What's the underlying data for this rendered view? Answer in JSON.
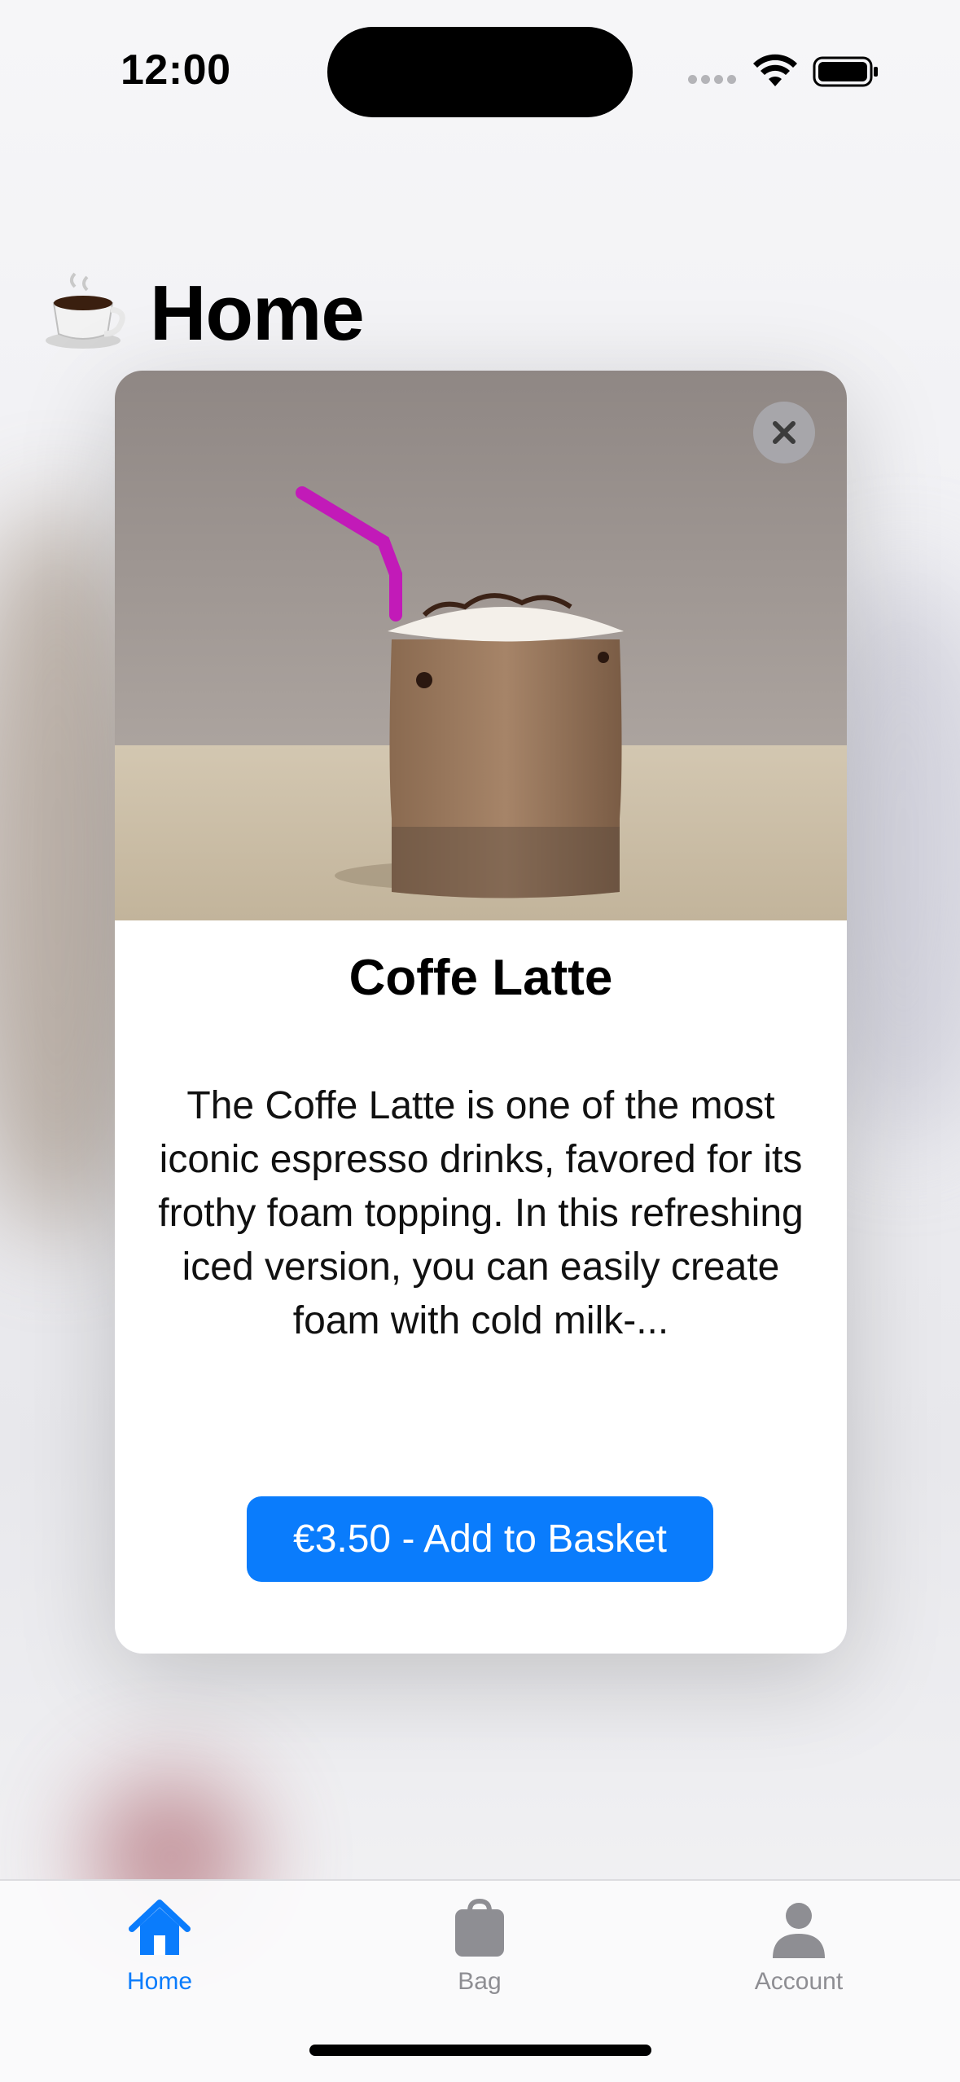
{
  "status_bar": {
    "time": "12:00"
  },
  "header": {
    "icon": "coffee-cup-icon",
    "title": "Home"
  },
  "modal": {
    "image": "iced-latte-photo",
    "close_icon": "close-icon",
    "product_name": "Coffe Latte",
    "description": "The Coffe Latte is one of the most iconic espresso drinks, favored for its frothy foam topping. In this refreshing iced version, you can easily create foam with cold milk-...",
    "add_button_label": "€3.50 - Add to Basket"
  },
  "tab_bar": {
    "active_color": "#0a7cfc",
    "inactive_color": "#8e8e93",
    "items": [
      {
        "label": "Home",
        "icon": "house-icon",
        "active": true
      },
      {
        "label": "Bag",
        "icon": "bag-icon",
        "active": false
      },
      {
        "label": "Account",
        "icon": "person-icon",
        "active": false
      }
    ]
  },
  "colors": {
    "accent": "#0a7cfc"
  }
}
